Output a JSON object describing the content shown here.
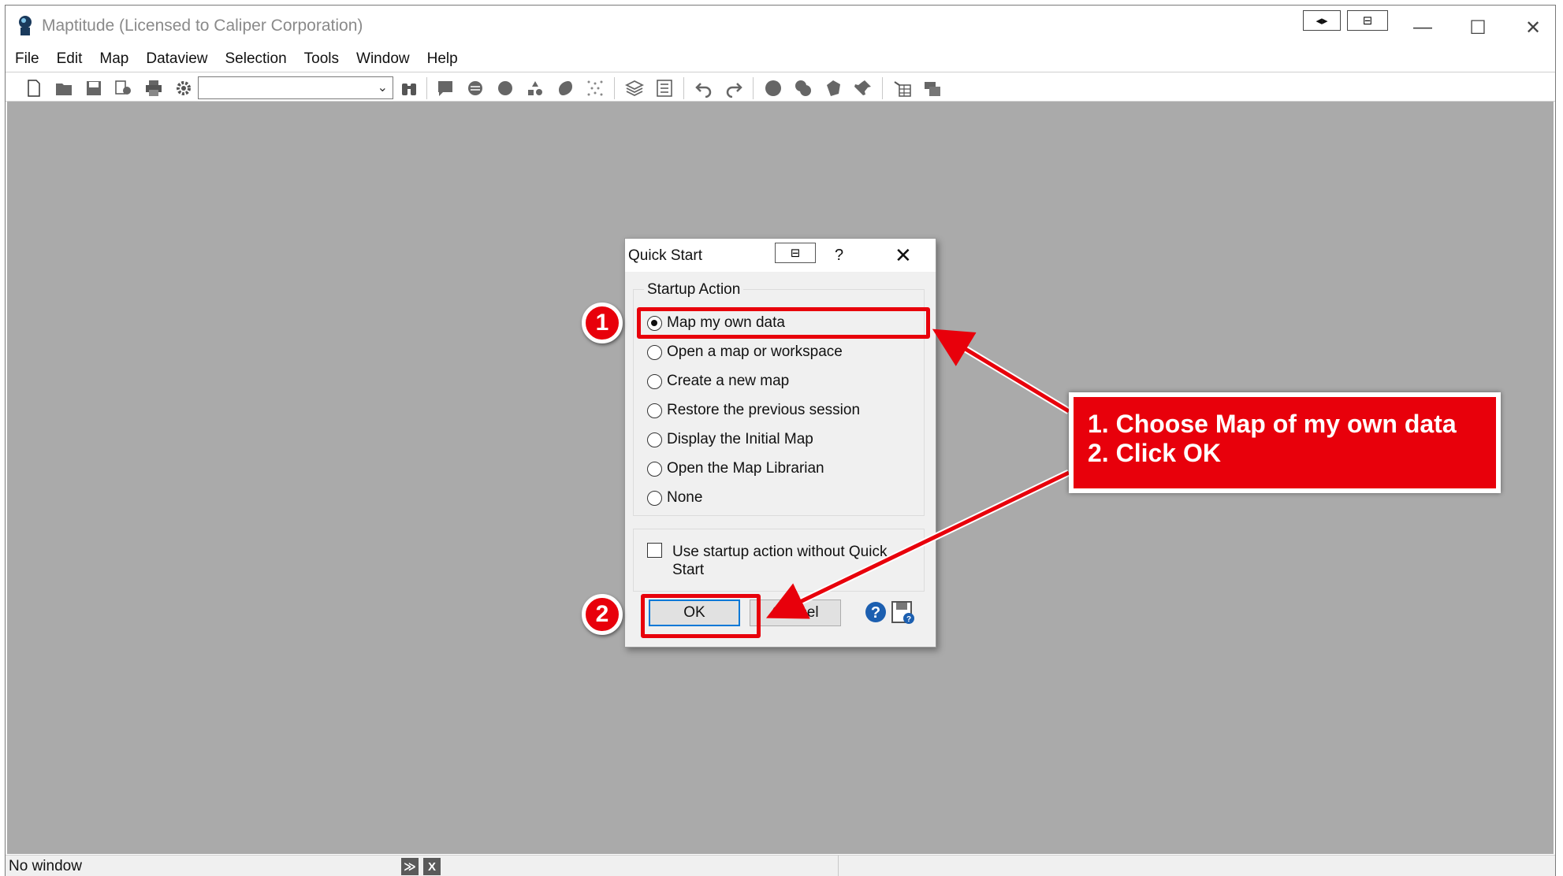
{
  "window": {
    "title": "Maptitude (Licensed to Caliper Corporation)",
    "controls": {
      "minimize": "—",
      "maximize": "☐",
      "close": "✕"
    },
    "mini_buttons": [
      "◂▸",
      "⊟"
    ]
  },
  "menu": [
    "File",
    "Edit",
    "Map",
    "Dataview",
    "Selection",
    "Tools",
    "Window",
    "Help"
  ],
  "toolbar": {
    "layer_combo_value": "",
    "icons": [
      "new-file-icon",
      "open-folder-icon",
      "save-icon",
      "print-preview-icon",
      "print-icon",
      "settings-icon",
      "binoculars-icon",
      "info-icon",
      "theme-icon",
      "circle-icon",
      "shapes-icon",
      "fill-icon",
      "dots-icon",
      "layers-icon",
      "legend-icon",
      "undo-icon",
      "redo-icon",
      "select-circle-icon",
      "select-multi-icon",
      "select-polygon-icon",
      "pin-icon",
      "table-icon",
      "copy-icon"
    ]
  },
  "status": {
    "text": "No window",
    "buttons": [
      "≫",
      "X"
    ]
  },
  "dialog": {
    "title": "Quick Start",
    "pin_label": "⊟",
    "help_label": "?",
    "close_label": "✕",
    "group_label": "Startup Action",
    "options": [
      {
        "label": "Map my own data",
        "selected": true
      },
      {
        "label": "Open a map or workspace",
        "selected": false
      },
      {
        "label": "Create a new map",
        "selected": false
      },
      {
        "label": "Restore the previous session",
        "selected": false
      },
      {
        "label": "Display the Initial Map",
        "selected": false
      },
      {
        "label": "Open the Map Librarian",
        "selected": false
      },
      {
        "label": "None",
        "selected": false
      }
    ],
    "checkbox_label": "Use startup action without Quick Start",
    "checkbox_checked": false,
    "ok_label": "OK",
    "cancel_label": "Cancel"
  },
  "annotations": {
    "badges": [
      "1",
      "2"
    ],
    "callout_lines": [
      "1. Choose Map of my own data",
      "2. Click OK"
    ],
    "color": "#e8000b"
  }
}
